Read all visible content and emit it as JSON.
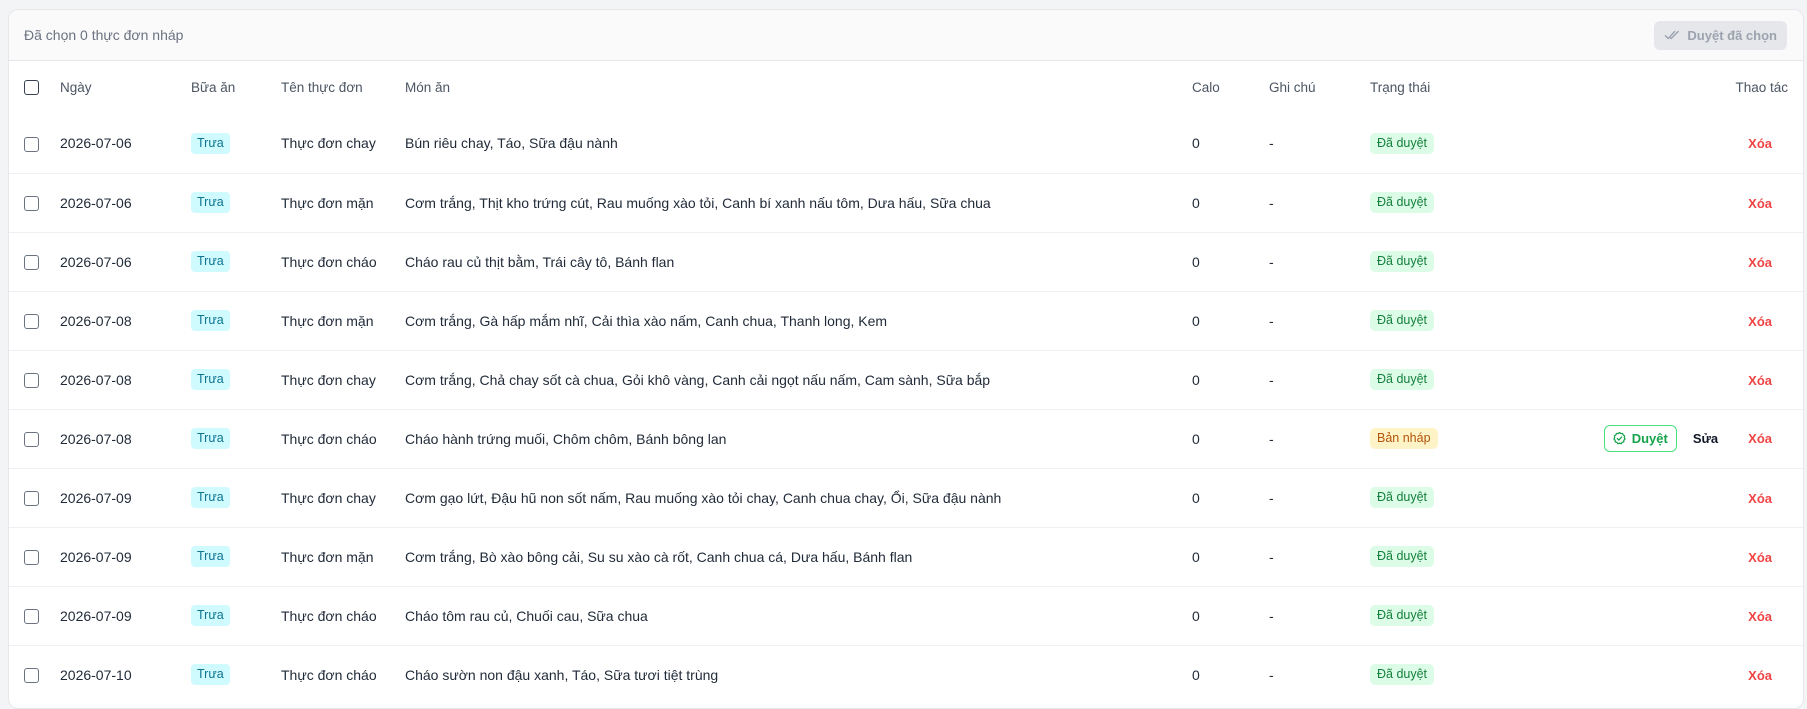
{
  "header": {
    "selected_text": "Đã chọn 0 thực đơn nháp",
    "bulk_approve_label": "Duyệt đã chọn"
  },
  "columns": {
    "date": "Ngày",
    "meal": "Bữa ăn",
    "menu_name": "Tên thực đơn",
    "dishes": "Món ăn",
    "calories": "Calo",
    "note": "Ghi chú",
    "status": "Trạng thái",
    "actions": "Thao tác"
  },
  "actions": {
    "approve": "Duyệt",
    "edit": "Sửa",
    "delete": "Xóa"
  },
  "rows": [
    {
      "date": "2026-07-06",
      "meal": "Trưa",
      "menu_name": "Thực đơn chay",
      "dishes": "Bún riêu chay, Táo, Sữa đậu nành",
      "calories": "0",
      "note": "-",
      "status": "Đã duyệt",
      "status_kind": "approved"
    },
    {
      "date": "2026-07-06",
      "meal": "Trưa",
      "menu_name": "Thực đơn mặn",
      "dishes": "Cơm trắng, Thịt kho trứng cút, Rau muống xào tỏi, Canh bí xanh nấu tôm, Dưa hấu, Sữa chua",
      "calories": "0",
      "note": "-",
      "status": "Đã duyệt",
      "status_kind": "approved"
    },
    {
      "date": "2026-07-06",
      "meal": "Trưa",
      "menu_name": "Thực đơn cháo",
      "dishes": "Cháo rau củ thịt bằm, Trái cây tô, Bánh flan",
      "calories": "0",
      "note": "-",
      "status": "Đã duyệt",
      "status_kind": "approved"
    },
    {
      "date": "2026-07-08",
      "meal": "Trưa",
      "menu_name": "Thực đơn mặn",
      "dishes": "Cơm trắng, Gà hấp mắm nhĩ, Cải thìa xào nấm, Canh chua, Thanh long, Kem",
      "calories": "0",
      "note": "-",
      "status": "Đã duyệt",
      "status_kind": "approved"
    },
    {
      "date": "2026-07-08",
      "meal": "Trưa",
      "menu_name": "Thực đơn chay",
      "dishes": "Cơm trắng, Chả chay sốt cà chua, Gỏi khô vàng, Canh cải ngọt nấu nấm, Cam sành, Sữa bắp",
      "calories": "0",
      "note": "-",
      "status": "Đã duyệt",
      "status_kind": "approved"
    },
    {
      "date": "2026-07-08",
      "meal": "Trưa",
      "menu_name": "Thực đơn cháo",
      "dishes": "Cháo hành trứng muối, Chôm chôm, Bánh bông lan",
      "calories": "0",
      "note": "-",
      "status": "Bản nháp",
      "status_kind": "draft"
    },
    {
      "date": "2026-07-09",
      "meal": "Trưa",
      "menu_name": "Thực đơn chay",
      "dishes": "Cơm gạo lứt, Đậu hũ non sốt nấm, Rau muống xào tỏi chay, Canh chua chay, Ổi, Sữa đậu nành",
      "calories": "0",
      "note": "-",
      "status": "Đã duyệt",
      "status_kind": "approved"
    },
    {
      "date": "2026-07-09",
      "meal": "Trưa",
      "menu_name": "Thực đơn mặn",
      "dishes": "Cơm trắng, Bò xào bông cải, Su su xào cà rốt, Canh chua cá, Dưa hấu, Bánh flan",
      "calories": "0",
      "note": "-",
      "status": "Đã duyệt",
      "status_kind": "approved"
    },
    {
      "date": "2026-07-09",
      "meal": "Trưa",
      "menu_name": "Thực đơn cháo",
      "dishes": "Cháo tôm rau củ, Chuối cau, Sữa chua",
      "calories": "0",
      "note": "-",
      "status": "Đã duyệt",
      "status_kind": "approved"
    },
    {
      "date": "2026-07-10",
      "meal": "Trưa",
      "menu_name": "Thực đơn cháo",
      "dishes": "Cháo sườn non đậu xanh, Táo, Sữa tươi tiệt trùng",
      "calories": "0",
      "note": "-",
      "status": "Đã duyệt",
      "status_kind": "approved"
    }
  ]
}
